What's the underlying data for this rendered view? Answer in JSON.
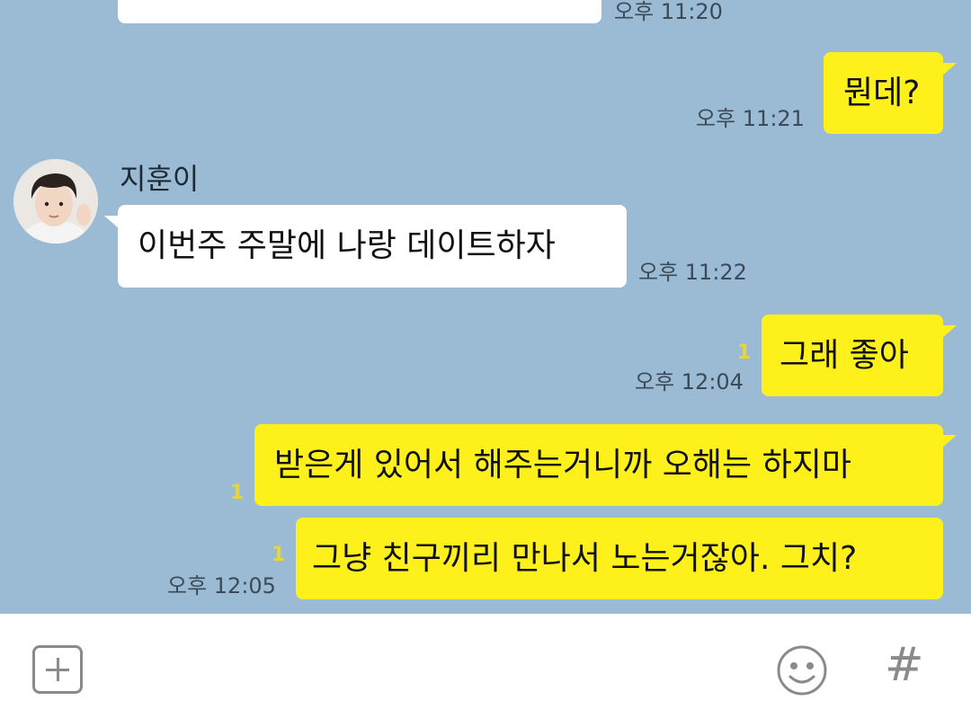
{
  "messages": [
    {
      "time": "오후 11:20"
    },
    {
      "text": "뭔데?",
      "time": "오후 11:21"
    },
    {
      "sender": "지훈이",
      "text": "이번주 주말에 나랑 데이트하자",
      "time": "오후 11:22"
    },
    {
      "text": "그래 좋아",
      "unread": "1",
      "time": "오후 12:04"
    },
    {
      "text": "받은게 있어서 해주는거니까 오해는 하지마",
      "unread": "1"
    },
    {
      "text": "그냥 친구끼리 만나서 노는거잖아. 그치?",
      "unread": "1",
      "time": "오후 12:05"
    }
  ],
  "input_bar": {
    "plus_icon": "plus-square-icon",
    "emoji_icon": "smiley-face-icon",
    "hash_label": "#"
  },
  "colors": {
    "chat_background": "#9bbbd4",
    "outgoing_bubble": "#fef01b",
    "incoming_bubble": "#ffffff",
    "unread_count": "#e8d53a"
  }
}
